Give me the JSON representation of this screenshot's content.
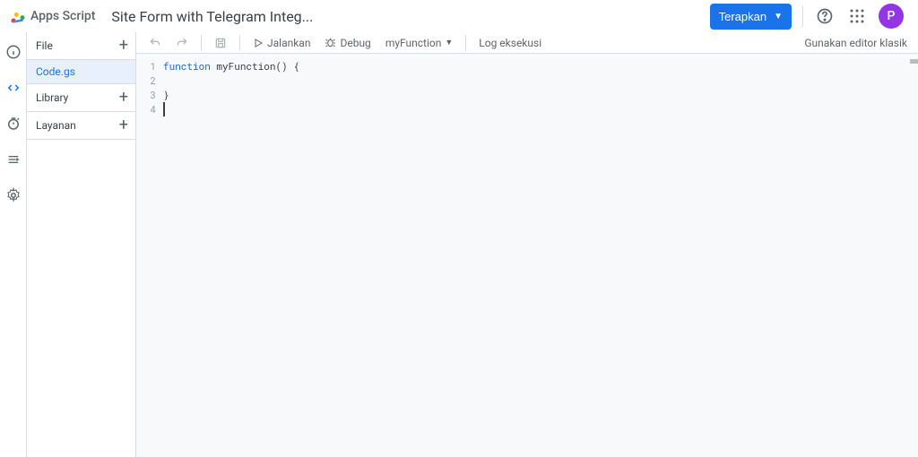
{
  "header": {
    "product": "Apps Script",
    "title": "Site Form with Telegram Integ...",
    "deploy_label": "Terapkan",
    "avatar_letter": "P"
  },
  "rail": {
    "items": [
      "info",
      "editor",
      "triggers",
      "executions",
      "settings"
    ]
  },
  "sidebar": {
    "file_label": "File",
    "files": [
      "Code.gs"
    ],
    "library_label": "Library",
    "services_label": "Layanan"
  },
  "toolbar": {
    "run": "Jalankan",
    "debug": "Debug",
    "fn": "myFunction",
    "log": "Log eksekusi",
    "classic": "Gunakan editor klasik"
  },
  "code": {
    "lines": [
      {
        "n": 1,
        "segments": [
          {
            "t": "function",
            "c": "kw"
          },
          {
            "t": " ",
            "c": ""
          },
          {
            "t": "myFunction",
            "c": "fn"
          },
          {
            "t": "() {",
            "c": "punct"
          }
        ]
      },
      {
        "n": 2,
        "segments": [
          {
            "t": "  ",
            "c": ""
          }
        ]
      },
      {
        "n": 3,
        "segments": [
          {
            "t": "}",
            "c": "punct"
          }
        ]
      },
      {
        "n": 4,
        "segments": []
      }
    ]
  }
}
